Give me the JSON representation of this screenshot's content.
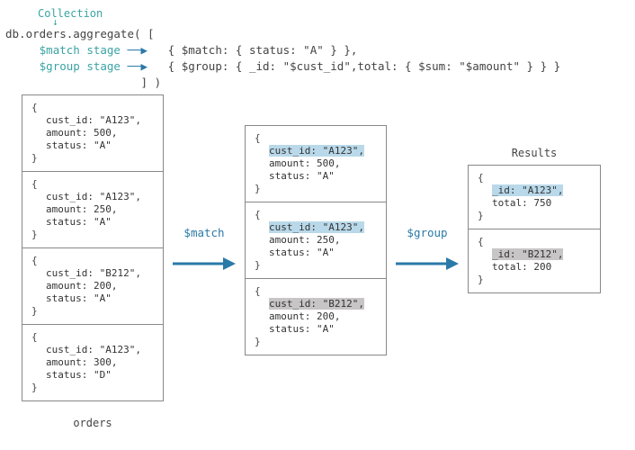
{
  "header": {
    "collection_label": "Collection",
    "code_main": "db.orders.aggregate( [",
    "match_stage_label": "$match stage",
    "group_stage_label": "$group stage",
    "match_code": "{ $match: { status: \"A\" } },",
    "group_code": "{ $group: { _id: \"$cust_id\",total: { $sum: \"$amount\" } } }",
    "code_close": "] )"
  },
  "orders_title": "orders",
  "results_title": "Results",
  "op_match": "$match",
  "op_group": "$group",
  "orders": [
    {
      "cust_id": "cust_id: \"A123\",",
      "amount": "amount: 500,",
      "status": "status: \"A\""
    },
    {
      "cust_id": "cust_id: \"A123\",",
      "amount": "amount: 250,",
      "status": "status: \"A\""
    },
    {
      "cust_id": "cust_id: \"B212\",",
      "amount": "amount: 200,",
      "status": "status: \"A\""
    },
    {
      "cust_id": "cust_id: \"A123\",",
      "amount": "amount: 300,",
      "status": "status: \"D\""
    }
  ],
  "matched": [
    {
      "cust_id": "cust_id: \"A123\",",
      "amount": "amount: 500,",
      "status": "status: \"A\"",
      "hl": "blue"
    },
    {
      "cust_id": "cust_id: \"A123\",",
      "amount": "amount: 250,",
      "status": "status: \"A\"",
      "hl": "blue"
    },
    {
      "cust_id": "cust_id: \"B212\",",
      "amount": "amount: 200,",
      "status": "status: \"A\"",
      "hl": "gray"
    }
  ],
  "results": [
    {
      "id": "_id: \"A123\",",
      "total": "total: 750",
      "hl": "blue"
    },
    {
      "id": "_id: \"B212\",",
      "total": "total: 200",
      "hl": "gray"
    }
  ]
}
